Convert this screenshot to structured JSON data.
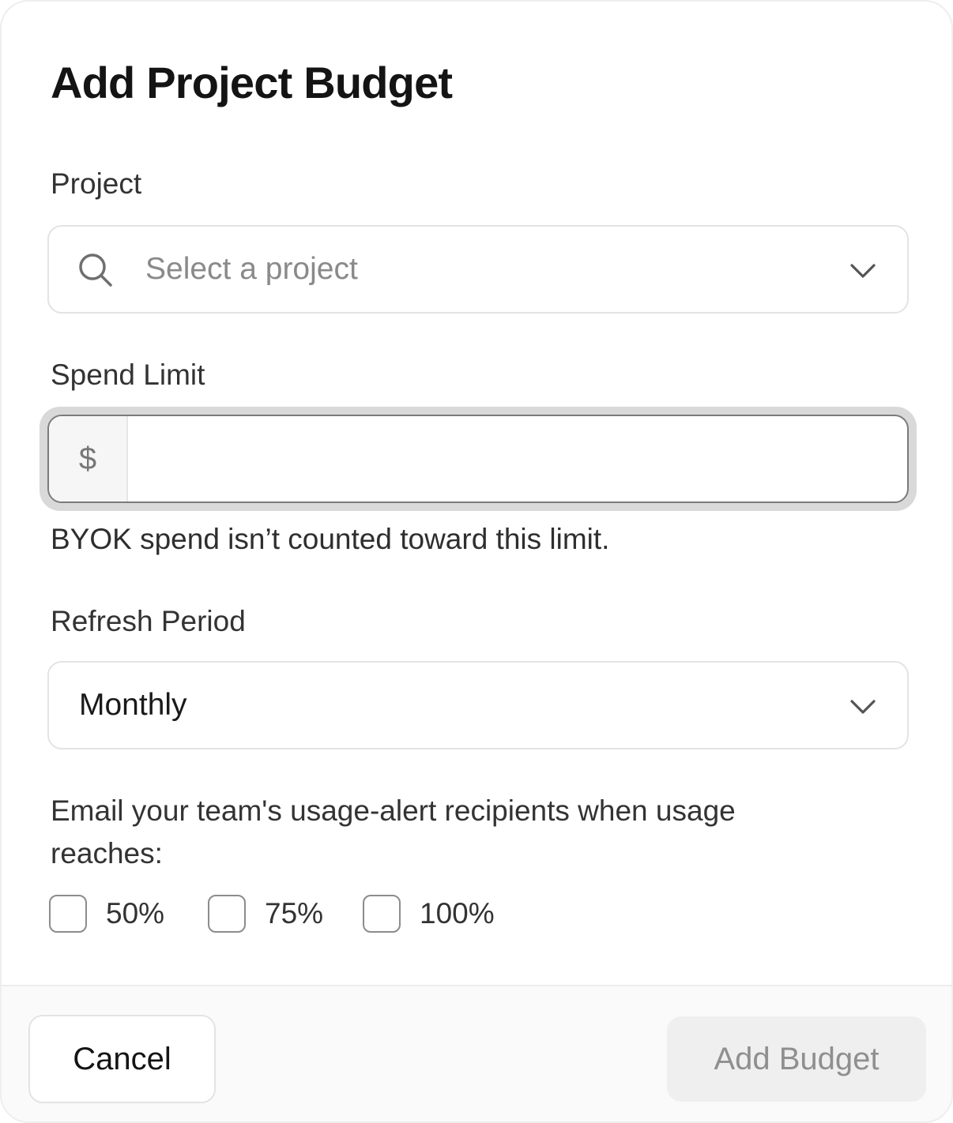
{
  "dialog": {
    "title": "Add Project Budget"
  },
  "project": {
    "label": "Project",
    "placeholder": "Select a project",
    "icon": "search-icon"
  },
  "spend_limit": {
    "label": "Spend Limit",
    "prefix": "$",
    "value": "",
    "hint": "BYOK spend isn’t counted toward this limit."
  },
  "refresh_period": {
    "label": "Refresh Period",
    "selected": "Monthly"
  },
  "alerts": {
    "text": "Email your team's usage-alert recipients when usage reaches:",
    "options": [
      {
        "label": "50%",
        "checked": false
      },
      {
        "label": "75%",
        "checked": false
      },
      {
        "label": "100%",
        "checked": false
      }
    ]
  },
  "footer": {
    "cancel_label": "Cancel",
    "submit_label": "Add Budget"
  },
  "colors": {
    "title": "#141414",
    "border": "#e3e3e3",
    "focus_ring": "#d9d9d9",
    "disabled_button_bg": "#efefef",
    "disabled_button_text": "#8f8f8f"
  }
}
